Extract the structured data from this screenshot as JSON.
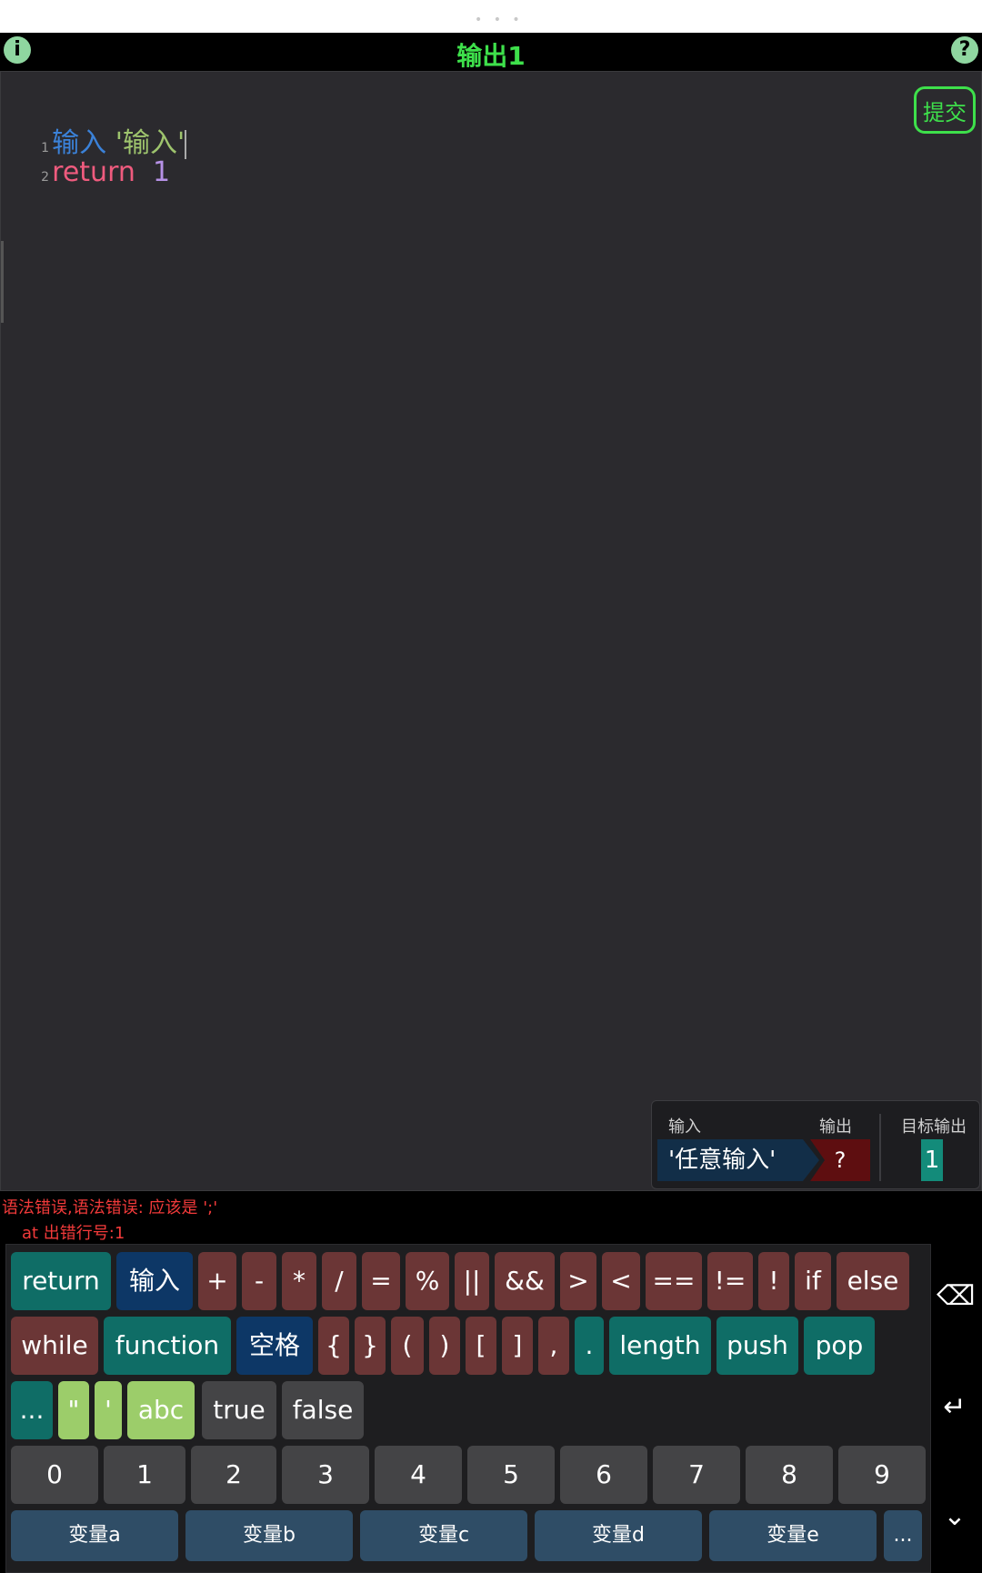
{
  "header": {
    "title": "输出1",
    "info_icon": "i",
    "help_icon": "?",
    "drag_handle": "• • •"
  },
  "editor": {
    "lines": [
      {
        "num": "1",
        "kw": "输入",
        "str": "'输入'"
      },
      {
        "num": "2",
        "kw": "return",
        "val": "1"
      }
    ],
    "submit_label": "提交"
  },
  "io_panel": {
    "input_label": "输入",
    "output_label": "输出",
    "target_label": "目标输出",
    "input_value": "'任意输入'",
    "output_value": "?",
    "target_value": "1"
  },
  "error": {
    "line1": "语法错误,语法错误: 应该是 ';'",
    "line2": "at 出错行号:1"
  },
  "keyboard": {
    "row1": [
      "return",
      "输入",
      "+",
      "-",
      "*",
      "/",
      "=",
      "%",
      "||",
      "&&",
      ">",
      "<",
      "==",
      "!=",
      "!",
      "if",
      "else"
    ],
    "row2": [
      "while",
      "function",
      "空格",
      "{",
      "}",
      "(",
      ")",
      "[",
      "]",
      ",",
      ".",
      "length",
      "push",
      "pop"
    ],
    "row3": [
      "...",
      "\"",
      "'",
      "abc",
      "true",
      "false"
    ],
    "row4": [
      "0",
      "1",
      "2",
      "3",
      "4",
      "5",
      "6",
      "7",
      "8",
      "9"
    ],
    "row5": [
      "变量a",
      "变量b",
      "变量c",
      "变量d",
      "变量e",
      "..."
    ],
    "side": {
      "backspace": "⌫",
      "enter": "↵",
      "hide": "⌄"
    }
  }
}
